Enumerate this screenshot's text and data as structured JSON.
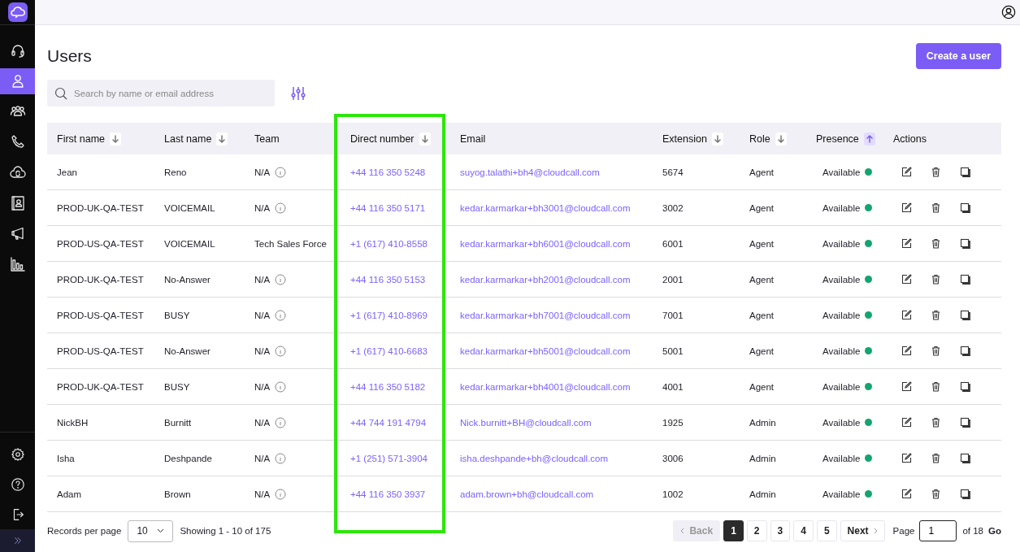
{
  "sidebar": {
    "items": [
      {
        "kind": "headset",
        "selected": false
      },
      {
        "kind": "user",
        "selected": true
      },
      {
        "kind": "group",
        "selected": false
      },
      {
        "kind": "phone",
        "selected": false
      },
      {
        "kind": "cloud-sync",
        "selected": false
      },
      {
        "kind": "contacts",
        "selected": false
      },
      {
        "kind": "megaphone",
        "selected": false
      },
      {
        "kind": "chart",
        "selected": false
      }
    ],
    "bottom_items": [
      {
        "kind": "settings"
      },
      {
        "kind": "help"
      },
      {
        "kind": "logout"
      },
      {
        "kind": "expand"
      }
    ]
  },
  "page": {
    "title": "Users",
    "create_button": "Create a user",
    "search": {
      "placeholder": "Search by name or email address"
    }
  },
  "table": {
    "columns": [
      {
        "label": "First name",
        "sortable": true,
        "ascending": false,
        "active": false,
        "highlighted": false
      },
      {
        "label": "Last name",
        "sortable": true,
        "ascending": false,
        "active": false,
        "highlighted": false
      },
      {
        "label": "Team",
        "sortable": false,
        "highlighted": false
      },
      {
        "label": "Direct number",
        "sortable": true,
        "ascending": false,
        "active": false,
        "highlighted": true
      },
      {
        "label": "Email",
        "sortable": false,
        "highlighted": false
      },
      {
        "label": "Extension",
        "sortable": true,
        "ascending": false,
        "active": false,
        "highlighted": false
      },
      {
        "label": "Role",
        "sortable": true,
        "ascending": false,
        "active": false,
        "highlighted": false
      },
      {
        "label": "Presence",
        "sortable": true,
        "ascending": true,
        "active": true,
        "highlighted": false
      },
      {
        "label": "Actions",
        "sortable": false,
        "highlighted": false
      }
    ],
    "rows": [
      {
        "first_name": "Jean",
        "last_name": "Reno",
        "team": "N/A",
        "team_info": true,
        "direct_number": "+44 116 350 5248",
        "email": "suyog.talathi+bh4@cloudcall.com",
        "extension": "5674",
        "role": "Agent",
        "presence": "Available",
        "color": "#12a56f"
      },
      {
        "first_name": "PROD-UK-QA-TEST",
        "last_name": "VOICEMAIL",
        "team": "N/A",
        "team_info": true,
        "direct_number": "+44 116 350 5171",
        "email": "kedar.karmarkar+bh3001@cloudcall.com",
        "extension": "3002",
        "role": "Agent",
        "presence": "Available",
        "color": "#12a56f"
      },
      {
        "first_name": "PROD-US-QA-TEST",
        "last_name": "VOICEMAIL",
        "team": "Tech Sales Force",
        "team_info": false,
        "direct_number": "+1 (617) 410-8558",
        "email": "kedar.karmarkar+bh6001@cloudcall.com",
        "extension": "6001",
        "role": "Agent",
        "presence": "Available",
        "color": "#12a56f"
      },
      {
        "first_name": "PROD-UK-QA-TEST",
        "last_name": "No-Answer",
        "team": "N/A",
        "team_info": true,
        "direct_number": "+44 116 350 5153",
        "email": "kedar.karmarkar+bh2001@cloudcall.com",
        "extension": "2001",
        "role": "Agent",
        "presence": "Available",
        "color": "#12a56f"
      },
      {
        "first_name": "PROD-US-QA-TEST",
        "last_name": "BUSY",
        "team": "N/A",
        "team_info": true,
        "direct_number": "+1 (617) 410-8969",
        "email": "kedar.karmarkar+bh7001@cloudcall.com",
        "extension": "7001",
        "role": "Agent",
        "presence": "Available",
        "color": "#12a56f"
      },
      {
        "first_name": "PROD-US-QA-TEST",
        "last_name": "No-Answer",
        "team": "N/A",
        "team_info": true,
        "direct_number": "+1 (617) 410-6683",
        "email": "kedar.karmarkar+bh5001@cloudcall.com",
        "extension": "5001",
        "role": "Agent",
        "presence": "Available",
        "color": "#12a56f"
      },
      {
        "first_name": "PROD-UK-QA-TEST",
        "last_name": "BUSY",
        "team": "N/A",
        "team_info": true,
        "direct_number": "+44 116 350 5182",
        "email": "kedar.karmarkar+bh4001@cloudcall.com",
        "extension": "4001",
        "role": "Agent",
        "presence": "Available",
        "color": "#12a56f"
      },
      {
        "first_name": "NickBH",
        "last_name": "Burnitt",
        "team": "N/A",
        "team_info": true,
        "direct_number": "+44 744 191 4794",
        "email": "Nick.burnitt+BH@cloudcall.com",
        "extension": "1925",
        "role": "Admin",
        "presence": "Available",
        "color": "#12a56f"
      },
      {
        "first_name": "Isha",
        "last_name": "Deshpande",
        "team": "N/A",
        "team_info": true,
        "direct_number": "+1 (251) 571-3904",
        "email": "isha.deshpande+bh@cloudcall.com",
        "extension": "3006",
        "role": "Admin",
        "presence": "Available",
        "color": "#12a56f"
      },
      {
        "first_name": "Adam",
        "last_name": "Brown",
        "team": "N/A",
        "team_info": true,
        "direct_number": "+44 116 350 3937",
        "email": "adam.brown+bh@cloudcall.com",
        "extension": "1002",
        "role": "Admin",
        "presence": "Available",
        "color": "#12a56f"
      }
    ]
  },
  "footer": {
    "records_label": "Records per page",
    "per_page": "10",
    "showing": "Showing 1 - 10 of 175",
    "back": {
      "label": "Back",
      "disabled": true
    },
    "pages": [
      {
        "label": "1",
        "selected": true
      },
      {
        "label": "2",
        "selected": false
      },
      {
        "label": "3",
        "selected": false
      },
      {
        "label": "4",
        "selected": false
      },
      {
        "label": "5",
        "selected": false
      }
    ],
    "next": {
      "label": "Next",
      "disabled": false
    },
    "page_label": "Page",
    "page_value": "1",
    "page_total": "of 18",
    "go": "Go"
  }
}
